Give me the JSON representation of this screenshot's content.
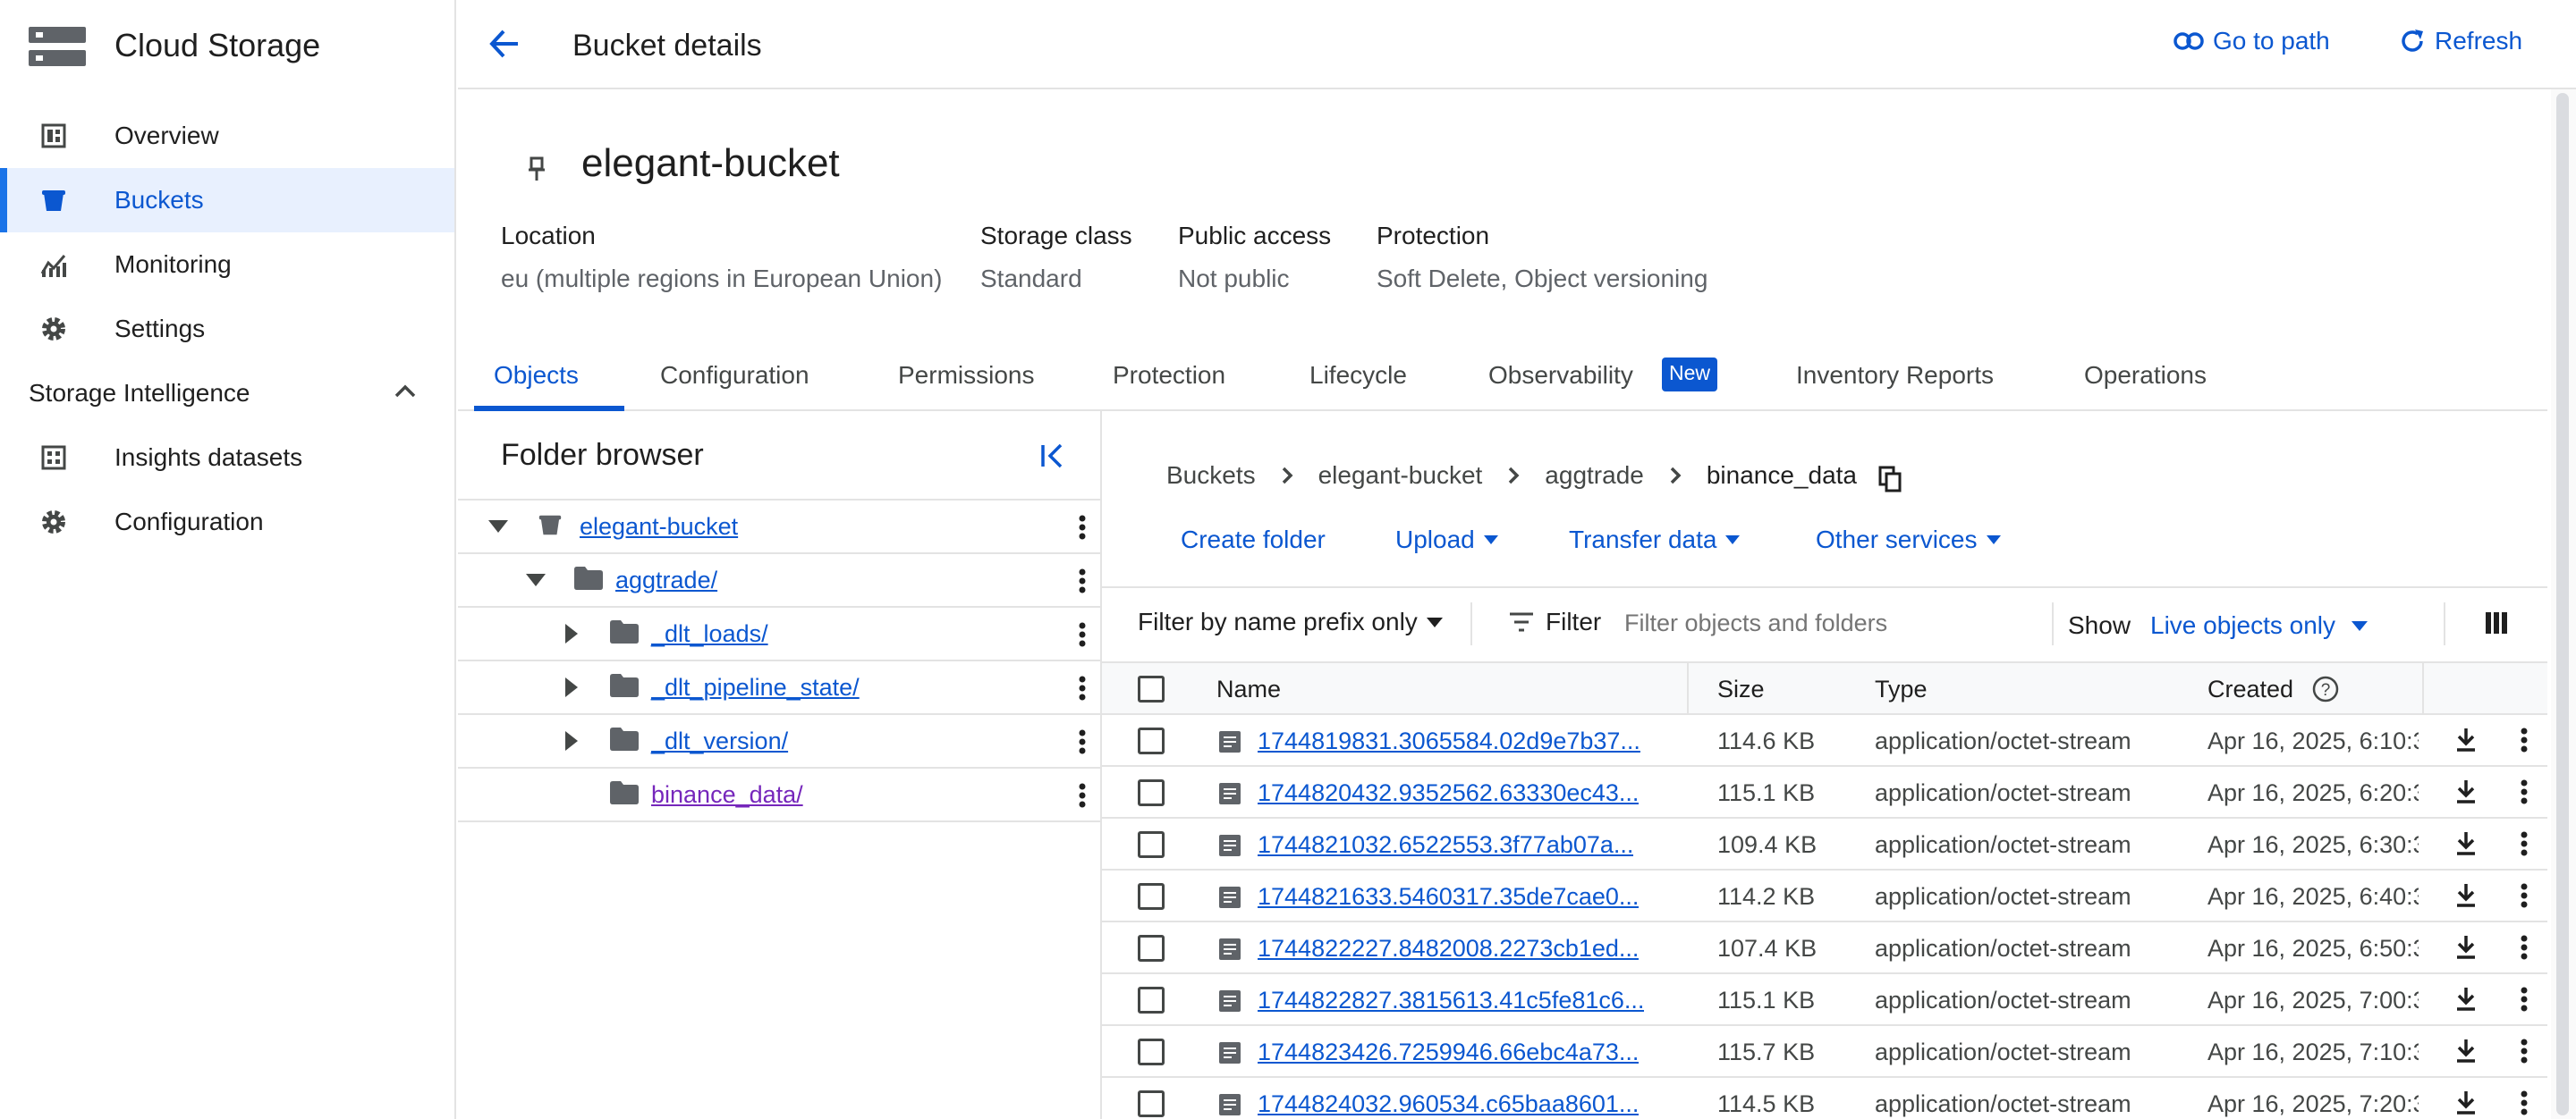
{
  "app": {
    "product_name": "Cloud Storage"
  },
  "sidebar": {
    "items": [
      {
        "label": "Overview",
        "icon": "dashboard-icon"
      },
      {
        "label": "Buckets",
        "icon": "bucket-icon",
        "active": true
      },
      {
        "label": "Monitoring",
        "icon": "monitoring-icon"
      },
      {
        "label": "Settings",
        "icon": "gear-icon"
      }
    ],
    "section_title": "Storage Intelligence",
    "section_items": [
      {
        "label": "Insights datasets",
        "icon": "dataset-icon"
      },
      {
        "label": "Configuration",
        "icon": "gear-icon"
      }
    ]
  },
  "header": {
    "title": "Bucket details",
    "go_to_path": "Go to path",
    "refresh": "Refresh"
  },
  "bucket": {
    "name": "elegant-bucket",
    "meta": [
      {
        "label": "Location",
        "value": "eu (multiple regions in European Union)"
      },
      {
        "label": "Storage class",
        "value": "Standard"
      },
      {
        "label": "Public access",
        "value": "Not public"
      },
      {
        "label": "Protection",
        "value": "Soft Delete, Object versioning"
      }
    ]
  },
  "tabs": [
    "Objects",
    "Configuration",
    "Permissions",
    "Protection",
    "Lifecycle",
    "Observability",
    "Inventory Reports",
    "Operations"
  ],
  "tab_badge": "New",
  "folder_browser": {
    "title": "Folder browser",
    "tree": [
      "elegant-bucket",
      "aggtrade/",
      "_dlt_loads/",
      "_dlt_pipeline_state/",
      "_dlt_version/",
      "binance_data/"
    ]
  },
  "breadcrumb": [
    "Buckets",
    "elegant-bucket",
    "aggtrade",
    "binance_data"
  ],
  "actions": {
    "create_folder": "Create folder",
    "upload": "Upload",
    "transfer": "Transfer data",
    "other": "Other services"
  },
  "filterbar": {
    "prefix": "Filter by name prefix only",
    "filter": "Filter",
    "placeholder": "Filter objects and folders",
    "show": "Show",
    "show_value": "Live objects only"
  },
  "table": {
    "headers": [
      "Name",
      "Size",
      "Type",
      "Created"
    ],
    "rows": [
      [
        "1744819831.3065584.02d9e7b37...",
        "114.6 KB",
        "application/octet-stream",
        "Apr 16, 2025, 6:10:3"
      ],
      [
        "1744820432.9352562.63330ec43...",
        "115.1 KB",
        "application/octet-stream",
        "Apr 16, 2025, 6:20:3"
      ],
      [
        "1744821032.6522553.3f77ab07a...",
        "109.4 KB",
        "application/octet-stream",
        "Apr 16, 2025, 6:30:3"
      ],
      [
        "1744821633.5460317.35de7cae0...",
        "114.2 KB",
        "application/octet-stream",
        "Apr 16, 2025, 6:40:3"
      ],
      [
        "1744822227.8482008.2273cb1ed...",
        "107.4 KB",
        "application/octet-stream",
        "Apr 16, 2025, 6:50:3"
      ],
      [
        "1744822827.3815613.41c5fe81c6...",
        "115.1 KB",
        "application/octet-stream",
        "Apr 16, 2025, 7:00:3"
      ],
      [
        "1744823426.7259946.66ebc4a73...",
        "115.7 KB",
        "application/octet-stream",
        "Apr 16, 2025, 7:10:3"
      ],
      [
        "1744824032.960534.c65baa8601...",
        "114.5 KB",
        "application/octet-stream",
        "Apr 16, 2025, 7:20:3"
      ]
    ]
  },
  "colors": {
    "accent": "#0b57d0",
    "active_bg": "#e8f0fe",
    "badge": "#0b57d0",
    "border": "#e3e3e3"
  }
}
